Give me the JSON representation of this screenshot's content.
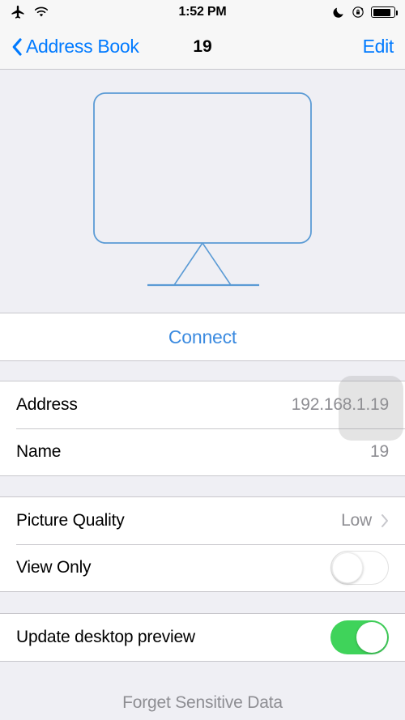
{
  "status_bar": {
    "airplane_icon": "airplane-mode-icon",
    "wifi_icon": "wifi-icon",
    "time": "1:52 PM",
    "dnd_icon": "moon-do-not-disturb-icon",
    "rotation_lock_icon": "rotation-lock-icon",
    "battery_icon": "battery-icon"
  },
  "nav_bar": {
    "back_icon": "chevron-left-icon",
    "back_label": "Address Book",
    "title": "19",
    "edit_label": "Edit"
  },
  "hero": {
    "illustration": "desktop-monitor-illustration",
    "stroke_color": "#5B9BD5"
  },
  "connect_section": {
    "connect_label": "Connect"
  },
  "details_section": {
    "rows": [
      {
        "label": "Address",
        "value": "192.168.1.19"
      },
      {
        "label": "Name",
        "value": "19"
      }
    ]
  },
  "options_section": {
    "picture_quality": {
      "label": "Picture Quality",
      "value": "Low",
      "chevron_icon": "chevron-right-icon"
    },
    "view_only": {
      "label": "View Only",
      "toggle_state": "off"
    }
  },
  "preview_section": {
    "update_desktop_preview": {
      "label": "Update desktop preview",
      "toggle_state": "on"
    }
  },
  "footer": {
    "forget_label": "Forget Sensitive Data"
  },
  "colors": {
    "accent_blue": "#007AFF",
    "connect_blue": "#3C8BE0",
    "toggle_green": "#3FD35A",
    "value_gray": "#8E8E93",
    "group_background": "#EFEFF4",
    "separator": "#C8C7CC"
  }
}
